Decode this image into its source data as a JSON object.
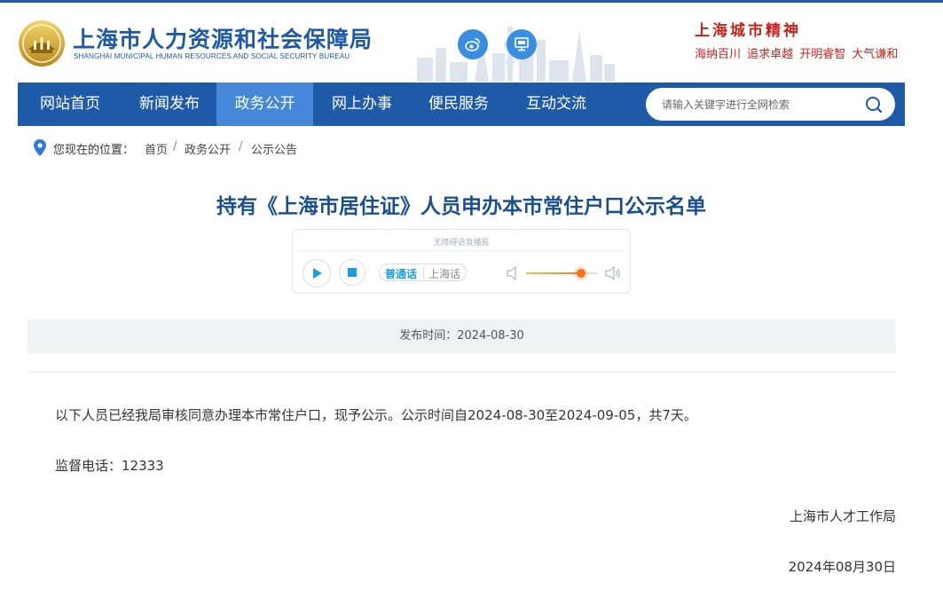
{
  "header": {
    "site_title": "上海市人力资源和社会保障局",
    "site_subtitle": "SHANGHAI MUNICIPAL HUMAN RESOURCES AND SOCIAL SECURITY BUREAU",
    "spirit_title": "上海城市精神",
    "spirit_slogan": "海纳百川 追求卓越 开明睿智 大气谦和",
    "icons": [
      "weibo-icon",
      "monitor-icon"
    ]
  },
  "nav": {
    "items": [
      {
        "label": "网站首页",
        "active": false
      },
      {
        "label": "新闻发布",
        "active": false
      },
      {
        "label": "政务公开",
        "active": true
      },
      {
        "label": "网上办事",
        "active": false
      },
      {
        "label": "便民服务",
        "active": false
      },
      {
        "label": "互动交流",
        "active": false
      }
    ],
    "search_placeholder": "请输入关键字进行全网检索"
  },
  "breadcrumb": {
    "label": "您现在的位置：",
    "items": [
      "首页",
      "政务公开",
      "公示公告"
    ],
    "separator": "/"
  },
  "article": {
    "title": "持有《上海市居住证》人员申办本市常住户口公示名单",
    "player": {
      "label": "无障碍语音播报",
      "lang_on": "普通话",
      "lang_off": "上海话",
      "volume_fraction": 0.77
    },
    "publish_time": "发布时间：2024-08-30",
    "paragraphs": [
      "以下人员已经我局审核同意办理本市常住户口，现予公示。公示时间自2024-08-30至2024-09-05，共7天。",
      "监督电话：12333"
    ],
    "signature": "上海市人才工作局",
    "sign_date": "2024年08月30日"
  },
  "colors": {
    "nav_bg": "#1f5aa8",
    "nav_active": "#4587d8",
    "title": "#1a4f8e",
    "spirit": "#c8211c",
    "accent_blue": "#1aa0e0",
    "volume": "#f4741c"
  }
}
